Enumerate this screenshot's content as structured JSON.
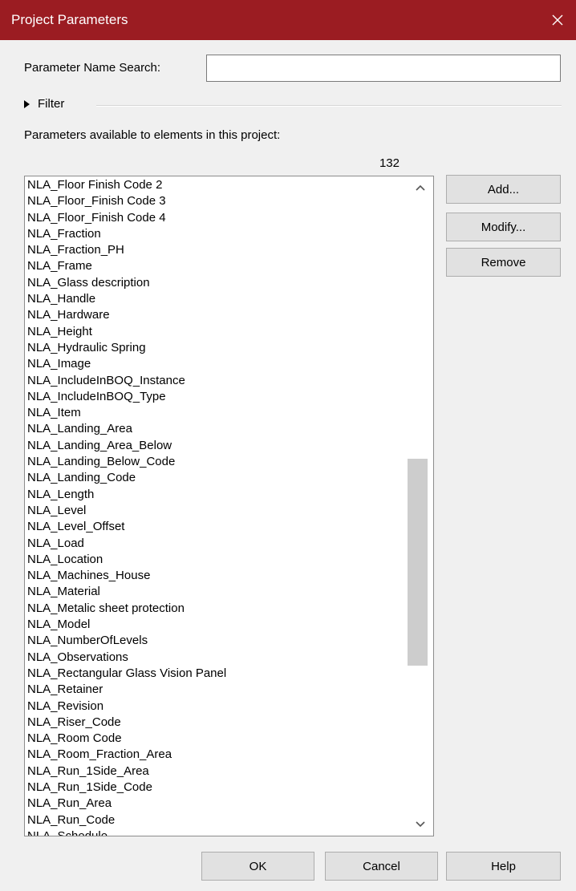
{
  "window": {
    "title": "Project Parameters"
  },
  "search": {
    "label": "Parameter Name Search:",
    "value": "",
    "placeholder": ""
  },
  "filter": {
    "label": "Filter"
  },
  "parameters": {
    "caption": "Parameters available to elements in this project:",
    "count": "132",
    "items": [
      "NLA_Floor Finish Code 2",
      "NLA_Floor_Finish Code 3",
      "NLA_Floor_Finish Code 4",
      "NLA_Fraction",
      "NLA_Fraction_PH",
      "NLA_Frame",
      "NLA_Glass description",
      "NLA_Handle",
      "NLA_Hardware",
      "NLA_Height",
      "NLA_Hydraulic Spring",
      "NLA_Image",
      "NLA_IncludeInBOQ_Instance",
      "NLA_IncludeInBOQ_Type",
      "NLA_Item",
      "NLA_Landing_Area",
      "NLA_Landing_Area_Below",
      "NLA_Landing_Below_Code",
      "NLA_Landing_Code",
      "NLA_Length",
      "NLA_Level",
      "NLA_Level_Offset",
      "NLA_Load",
      "NLA_Location",
      "NLA_Machines_House",
      "NLA_Material",
      "NLA_Metalic sheet protection",
      "NLA_Model",
      "NLA_NumberOfLevels",
      "NLA_Observations",
      "NLA_Rectangular Glass Vision Panel",
      "NLA_Retainer",
      "NLA_Revision",
      "NLA_Riser_Code",
      "NLA_Room Code",
      "NLA_Room_Fraction_Area",
      "NLA_Run_1Side_Area",
      "NLA_Run_1Side_Code",
      "NLA_Run_Area",
      "NLA_Run_Code",
      "NLA_Schedule"
    ]
  },
  "buttons": {
    "add": "Add...",
    "modify": "Modify...",
    "remove": "Remove",
    "ok": "OK",
    "cancel": "Cancel",
    "help": "Help"
  },
  "icons": {
    "close": "close-icon",
    "filter_expand": "triangle-right-icon",
    "scroll_up": "chevron-up-icon",
    "scroll_down": "chevron-down-icon"
  },
  "colors": {
    "titlebar": "#9b1c22",
    "dialog_bg": "#f0f0f0",
    "button_bg": "#e1e1e1",
    "scroll_thumb": "#cdcdcd"
  }
}
